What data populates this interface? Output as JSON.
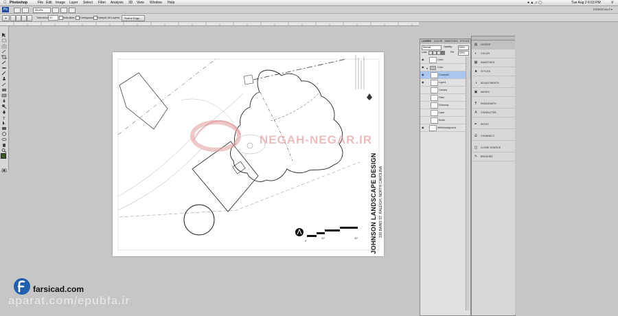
{
  "menubar": {
    "app": "Photoshop",
    "items": [
      "File",
      "Edit",
      "Image",
      "Layer",
      "Select",
      "Filter",
      "Analysis",
      "3D",
      "View",
      "Window",
      "Help"
    ],
    "clock": "Tue Aug 2  6:03 PM"
  },
  "appbar": {
    "zoom": "33.4%",
    "workspace": "ESSENTIALS ▾"
  },
  "options": {
    "tolerance_label": "Tolerance:",
    "tolerance_value": "32",
    "antialias": "Anti-alias",
    "contiguous": "Contiguous",
    "sample_all": "Sample All Layers",
    "refine_edge": "Refine Edge..."
  },
  "drawing": {
    "title": "JOHNSON LANDSCAPE DESIGN",
    "address": "330 BAINS ST. RALEIGH, NORTH CAROLINA",
    "scale_labels": [
      "0'",
      "20'",
      "40'"
    ],
    "watermark": "NEGAH-NEGAR.IR"
  },
  "layers_panel": {
    "tabs": [
      "LAYERS",
      "COLOR",
      "SWATCHES",
      "STYLES"
    ],
    "blend_mode": "Normal",
    "opacity_label": "Opacity:",
    "opacity": "100%",
    "lock_label": "Lock:",
    "fill_label": "Fill:",
    "fill": "100%",
    "layers": [
      {
        "name": "Lines",
        "visible": true,
        "selected": false
      },
      {
        "name": "Color",
        "visible": true,
        "selected": false
      },
      {
        "name": "Concept2",
        "visible": true,
        "selected": true
      },
      {
        "name": "Layer1",
        "visible": true,
        "selected": false
      },
      {
        "name": "Canopy",
        "visible": false,
        "selected": false
      },
      {
        "name": "Patio",
        "visible": false,
        "selected": false
      },
      {
        "name": "Driveway",
        "visible": false,
        "selected": false
      },
      {
        "name": "Lawn",
        "visible": false,
        "selected": false
      },
      {
        "name": "Mulch",
        "visible": false,
        "selected": false
      },
      {
        "name": "Whitebackground",
        "visible": true,
        "selected": false
      }
    ]
  },
  "dock": {
    "items": [
      {
        "label": "LAYERS",
        "icon": "layers-icon"
      },
      {
        "label": "COLOR",
        "icon": "color-icon"
      },
      {
        "label": "SWATCHES",
        "icon": "swatches-icon"
      },
      {
        "label": "STYLES",
        "icon": "styles-icon"
      },
      {
        "label": "ADJUSTMENTS",
        "icon": "adjustments-icon"
      },
      {
        "label": "MASKS",
        "icon": "masks-icon"
      },
      {
        "label": "PARAGRAPH",
        "icon": "paragraph-icon"
      },
      {
        "label": "CHARACTER",
        "icon": "character-icon"
      },
      {
        "label": "PATHS",
        "icon": "paths-icon"
      },
      {
        "label": "CHANNELS",
        "icon": "channels-icon"
      },
      {
        "label": "CLONE SOURCE",
        "icon": "clone-source-icon"
      },
      {
        "label": "BRUSHES",
        "icon": "brushes-icon"
      }
    ]
  },
  "overlay": {
    "brand": "farsicad.com",
    "url": "aparat.com/epubfa.ir"
  },
  "colors": {
    "selection": "#a9c7ee",
    "brand_blue": "#1f5fae"
  }
}
